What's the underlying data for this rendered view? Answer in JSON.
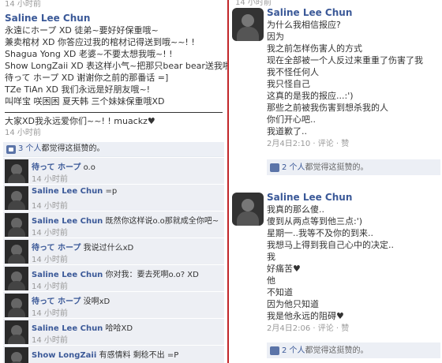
{
  "left": {
    "top_meta": "14 小时前",
    "post": {
      "author": "Saline Lee Chun",
      "lines": [
        "永遠にホープ XD 徒弟~要好好保重哦~",
        "兼卖棺材 XD 你答应过我的棺材记得送到哦~~! !",
        "Shagua Yong XD 老婆~不要太想我哦~! !",
        "Show LongZaii XD 表这样小气~把那只bear bear送我啦",
        "待って ホープ XD 谢谢你之前的那番话 =]",
        "TZe TiAn XD 我们永远是好朋友哦~!",
        "叫咩宝 咲困困 夏天韩 三个妹妹保重哦XD"
      ],
      "farewell": "大家XD我永远爱你们~~! ! muackz♥",
      "time": "14 小时前",
      "likes": {
        "count": "3 个人",
        "text": "都觉得这挺赞的。"
      }
    },
    "comments": [
      {
        "author": "待って ホープ",
        "text": "o.o",
        "time": "14 小时前"
      },
      {
        "author": "Saline Lee Chun",
        "text": "=p",
        "time": "14 小时前"
      },
      {
        "author": "Saline Lee Chun",
        "text": "既然你这样说o.o那就成全你吧~",
        "time": "14 小时前"
      },
      {
        "author": "待って ホープ",
        "text": "我说过什么xD",
        "time": "14 小时前"
      },
      {
        "author": "Saline Lee Chun",
        "text": "你对我：要去死啊o.o? XD",
        "time": "14 小时前"
      },
      {
        "author": "待って ホープ",
        "text": "没啊xD",
        "time": "14 小时前"
      },
      {
        "author": "Saline Lee Chun",
        "text": "哈哈XD",
        "time": "14 小时前"
      },
      {
        "author": "Show LongZaii",
        "text": "有感情料 剩稔不出 =P",
        "time": ""
      }
    ]
  },
  "right": {
    "top_meta": "14 小时前",
    "posts": [
      {
        "author": "Saline Lee Chun",
        "lines": [
          "为什么我相信报应?",
          "因为",
          "我之前怎样伤害人的方式",
          "现在全部被一个人反过来重重了伤害了我",
          "我不怪任何人",
          "我只怪自己",
          "这真的是我的报应...:')",
          "那些之前被我伤害到想杀我的人",
          "你们开心吧..",
          "我道歉了.."
        ],
        "time": "2月4日2:10",
        "comment_label": "评论",
        "like_label": "赞",
        "likes": {
          "count": "2 个人",
          "text": "都觉得这挺赞的。"
        }
      },
      {
        "author": "Saline Lee Chun",
        "lines": [
          "我真的那么傻..",
          "傻到从两点等到他三点:')",
          "星期一..我等不及你的到来..",
          "我想马上得到我自己心中的决定..",
          "我",
          "好痛苦♥",
          "他",
          "不知道",
          "因为他只知道",
          "我是他永远的阻碍♥"
        ],
        "time": "2月4日2:06",
        "comment_label": "评论",
        "like_label": "赞",
        "likes": {
          "count": "2 个人",
          "text": "都觉得这挺赞的。"
        }
      }
    ]
  }
}
